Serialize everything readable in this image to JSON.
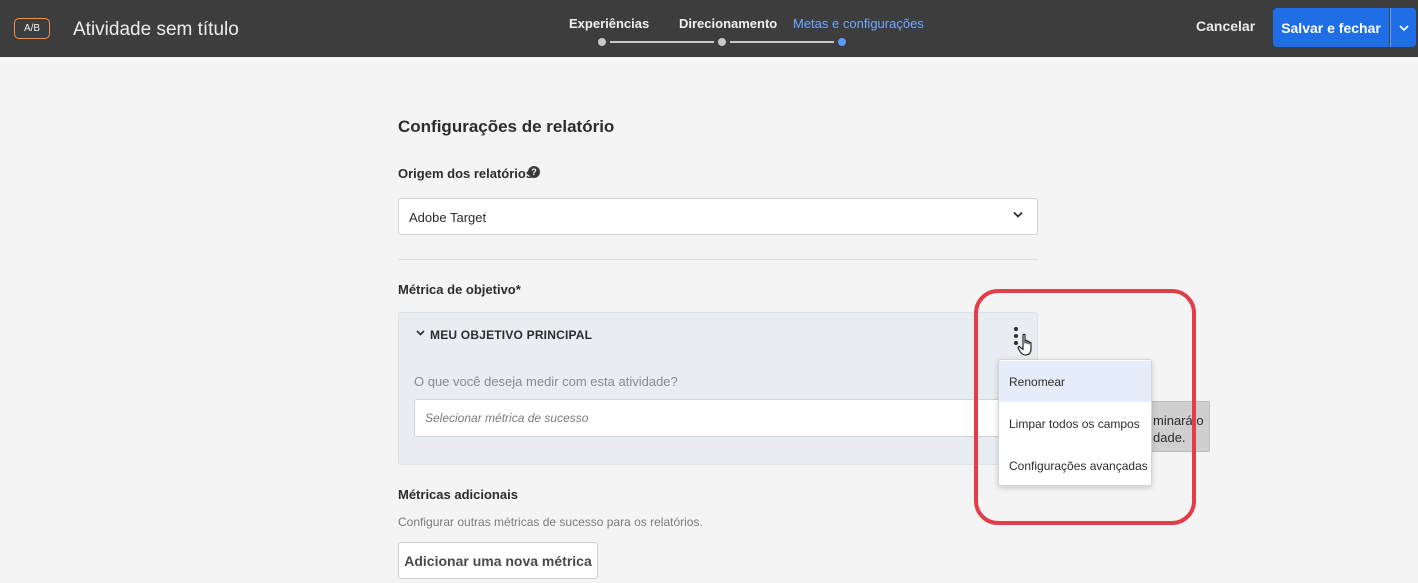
{
  "header": {
    "badge": "A/B",
    "title": "Atividade sem título",
    "steps": [
      {
        "label": "Experiências",
        "active": false
      },
      {
        "label": "Direcionamento",
        "active": false
      },
      {
        "label": "Metas e configurações",
        "active": true
      }
    ],
    "cancel_label": "Cancelar",
    "save_label": "Salvar e fechar"
  },
  "report_settings": {
    "title": "Configurações de relatório",
    "source_label": "Origem dos relatórios",
    "help_glyph": "?",
    "source_value": "Adobe Target"
  },
  "goal_metric": {
    "label": "Métrica de objetivo*",
    "panel_title": "MEU OBJETIVO PRINCIPAL",
    "question": "O que você deseja medir com esta atividade?",
    "input_placeholder": "Selecionar métrica de sucesso"
  },
  "tooltip_behind": {
    "line1": "minará o",
    "line2": "dade."
  },
  "additional_metrics": {
    "label": "Métricas adicionais",
    "description": "Configurar outras métricas de sucesso para os relatórios.",
    "add_button": "Adicionar uma nova métrica"
  },
  "context_menu": {
    "items": [
      {
        "label": "Renomear",
        "highlighted": true
      },
      {
        "label": "Limpar todos os campos",
        "highlighted": false
      },
      {
        "label": "Configurações avançadas",
        "highlighted": false
      }
    ]
  },
  "colors": {
    "accent": "#1f6ee6",
    "active_step": "#6ea8ff",
    "annotation": "#e43c48",
    "badge_border": "#e8925a"
  },
  "icons": {
    "help": "help-circle-icon",
    "select_chevron": "chevron-down-icon",
    "panel_chevron": "chevron-down-icon",
    "kebab": "more-vertical-icon",
    "cursor": "hand-pointer-icon"
  }
}
